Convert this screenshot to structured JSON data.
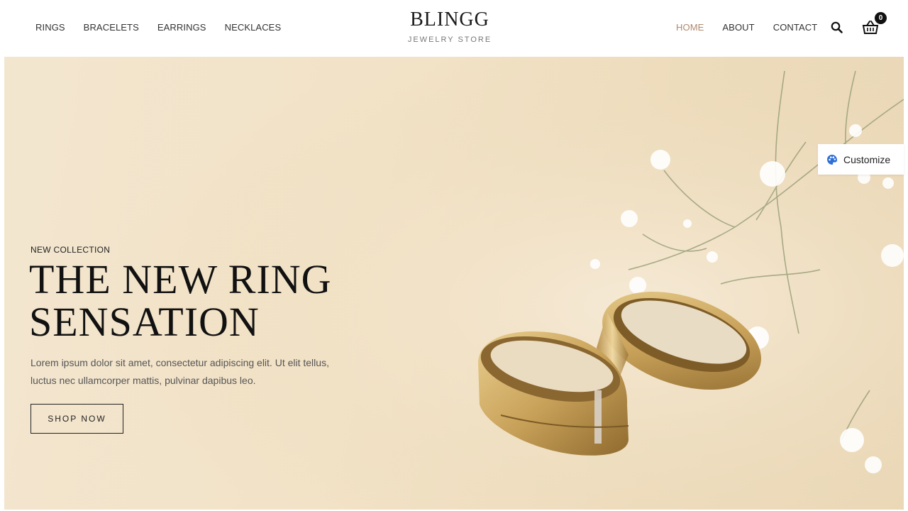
{
  "header": {
    "nav_left": [
      {
        "label": "RINGS"
      },
      {
        "label": "BRACELETS"
      },
      {
        "label": "EARRINGS"
      },
      {
        "label": "NECKLACES"
      }
    ],
    "logo": {
      "title": "BLINGG",
      "subtitle": "JEWELRY STORE"
    },
    "nav_right": [
      {
        "label": "HOME",
        "active": true
      },
      {
        "label": "ABOUT",
        "active": false
      },
      {
        "label": "CONTACT",
        "active": false
      }
    ],
    "cart_count": "0",
    "icons": {
      "search": "search-icon",
      "cart": "basket-icon"
    }
  },
  "hero": {
    "eyebrow": "NEW COLLECTION",
    "headline": "THE NEW RING SENSATION",
    "description": "Lorem ipsum dolor sit amet, consectetur adipiscing elit. Ut elit tellus, luctus nec ullamcorper mattis, pulvinar dapibus leo.",
    "cta_label": "SHOP NOW"
  },
  "customize": {
    "label": "Customize",
    "icon": "palette-icon"
  },
  "colors": {
    "active_nav": "#b08a6e",
    "hero_bg": "#f2e2c6",
    "accent_blue": "#2f6fd6"
  }
}
